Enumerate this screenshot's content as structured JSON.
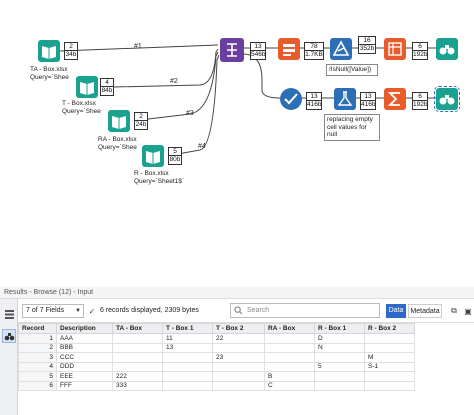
{
  "canvas": {
    "inputs": [
      {
        "stat_records": "2",
        "stat_size": "34b",
        "config_label": "",
        "connection": "#1"
      },
      {
        "stat_records": "4",
        "stat_size": "84b",
        "config_label": "TA - Box.xlsx\nQuery=`Shee",
        "connection": "#2"
      },
      {
        "stat_records": "2",
        "stat_size": "24b",
        "config_label": "T - Box.xlsx\nQuery=`Shee",
        "connection": "#3"
      },
      {
        "stat_records": "5",
        "stat_size": "80b",
        "config_label": "RA - Box.xlsx\nQuery=`Shee",
        "connection": "#4"
      }
    ],
    "last_input_label": "R - Box.xlsx\nQuery=`Sheet1$`",
    "union_stats": {
      "records": "13",
      "size": "546b"
    },
    "top_branch": [
      {
        "records": "78",
        "size": "1.7KB"
      },
      {
        "records": "16",
        "size": "352b"
      },
      {
        "records": "6",
        "size": "192b"
      }
    ],
    "filter_label": "!IsNull([Value])",
    "bottom_branch": [
      {
        "records": "13",
        "size": "416b"
      },
      {
        "records": "13",
        "size": "416b"
      },
      {
        "records": "6",
        "size": "192b"
      }
    ],
    "formula_label": "replacing empty\ncell values for\nnull"
  },
  "results": {
    "title": "Results - Browse (12) - Input",
    "fields_selector": "7 of 7 Fields",
    "record_info": "6 records displayed, 2309 bytes",
    "search_placeholder": "Search",
    "tab_data": "Data",
    "tab_metadata": "Metadata",
    "columns": [
      "Record",
      "Description",
      "TA - Box",
      "T - Box 1",
      "T - Box 2",
      "RA - Box",
      "R - Box 1",
      "R - Box 2"
    ],
    "rows": [
      [
        "1",
        "AAA",
        "",
        "11",
        "22",
        "",
        "D",
        ""
      ],
      [
        "2",
        "BBB",
        "",
        "13",
        "",
        "",
        "N",
        ""
      ],
      [
        "3",
        "CCC",
        "",
        "",
        "23",
        "",
        "",
        "M"
      ],
      [
        "4",
        "DDD",
        "",
        "",
        "",
        "",
        "5",
        "S-1"
      ],
      [
        "5",
        "EEE",
        "222",
        "",
        "",
        "B",
        "",
        ""
      ],
      [
        "6",
        "FFF",
        "333",
        "",
        "",
        "C",
        "",
        ""
      ]
    ]
  },
  "colors": {
    "input_tool": "#1aa190",
    "union_tool": "#6b3fa0",
    "filter_tool": "#2c6fb7",
    "formula_tool": "#2c6fb7",
    "summarize_tool": "#e85b2a",
    "browse_tool": "#1aa190",
    "accent": "#2d6ac7"
  }
}
